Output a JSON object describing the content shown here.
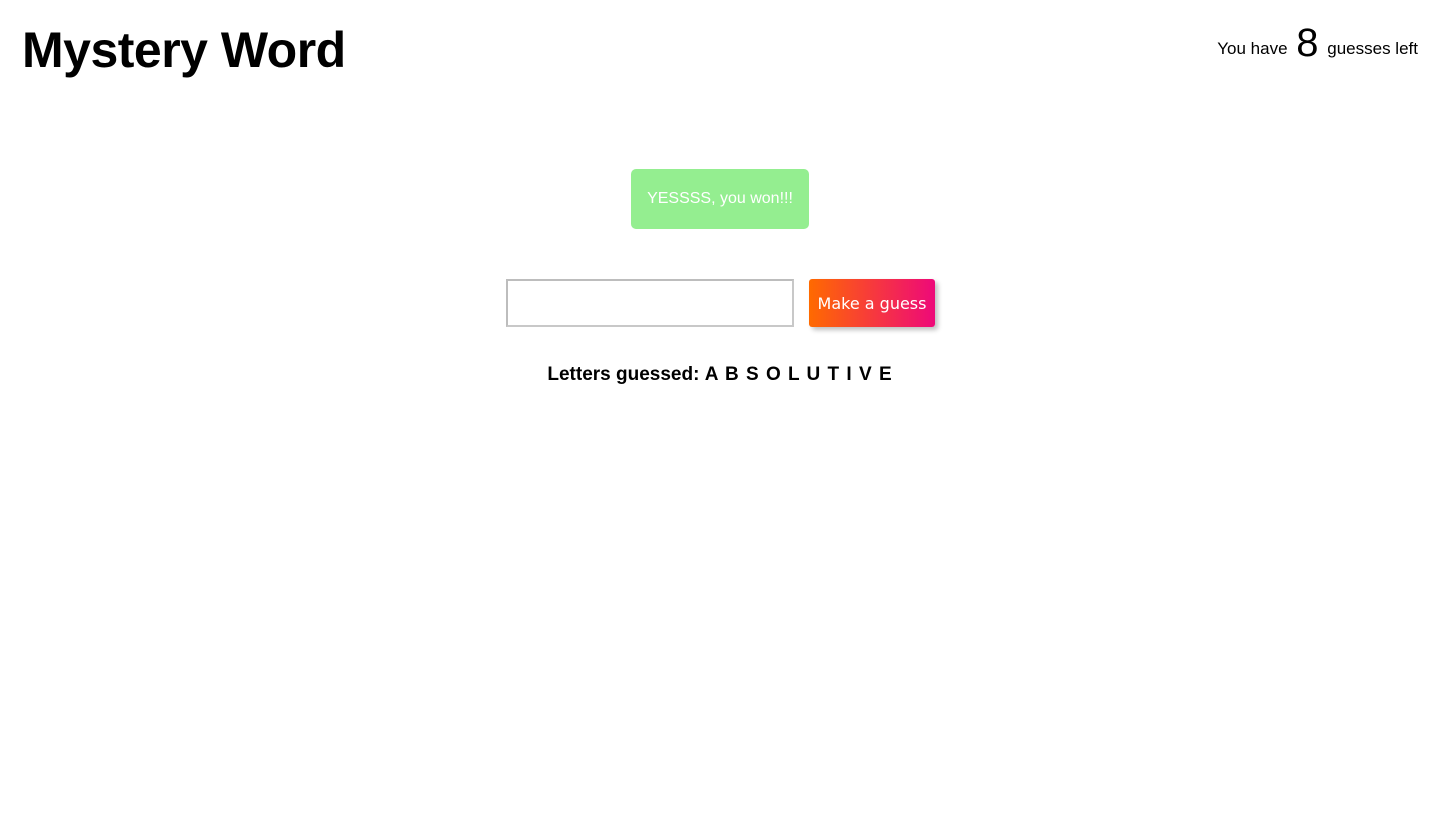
{
  "header": {
    "title": "Mystery Word",
    "guesses_prefix": "You have",
    "guesses_count": "8",
    "guesses_suffix": "guesses left"
  },
  "status": {
    "message": "YESSSS, you won!!!",
    "color": "#94ee90"
  },
  "guess_form": {
    "input_value": "",
    "button_label": "Make a guess",
    "button_gradient": [
      "#ff6a00",
      "#ee0979"
    ]
  },
  "letters_guessed": {
    "label": "Letters guessed:",
    "letters": "A B S O L U T I V E"
  }
}
